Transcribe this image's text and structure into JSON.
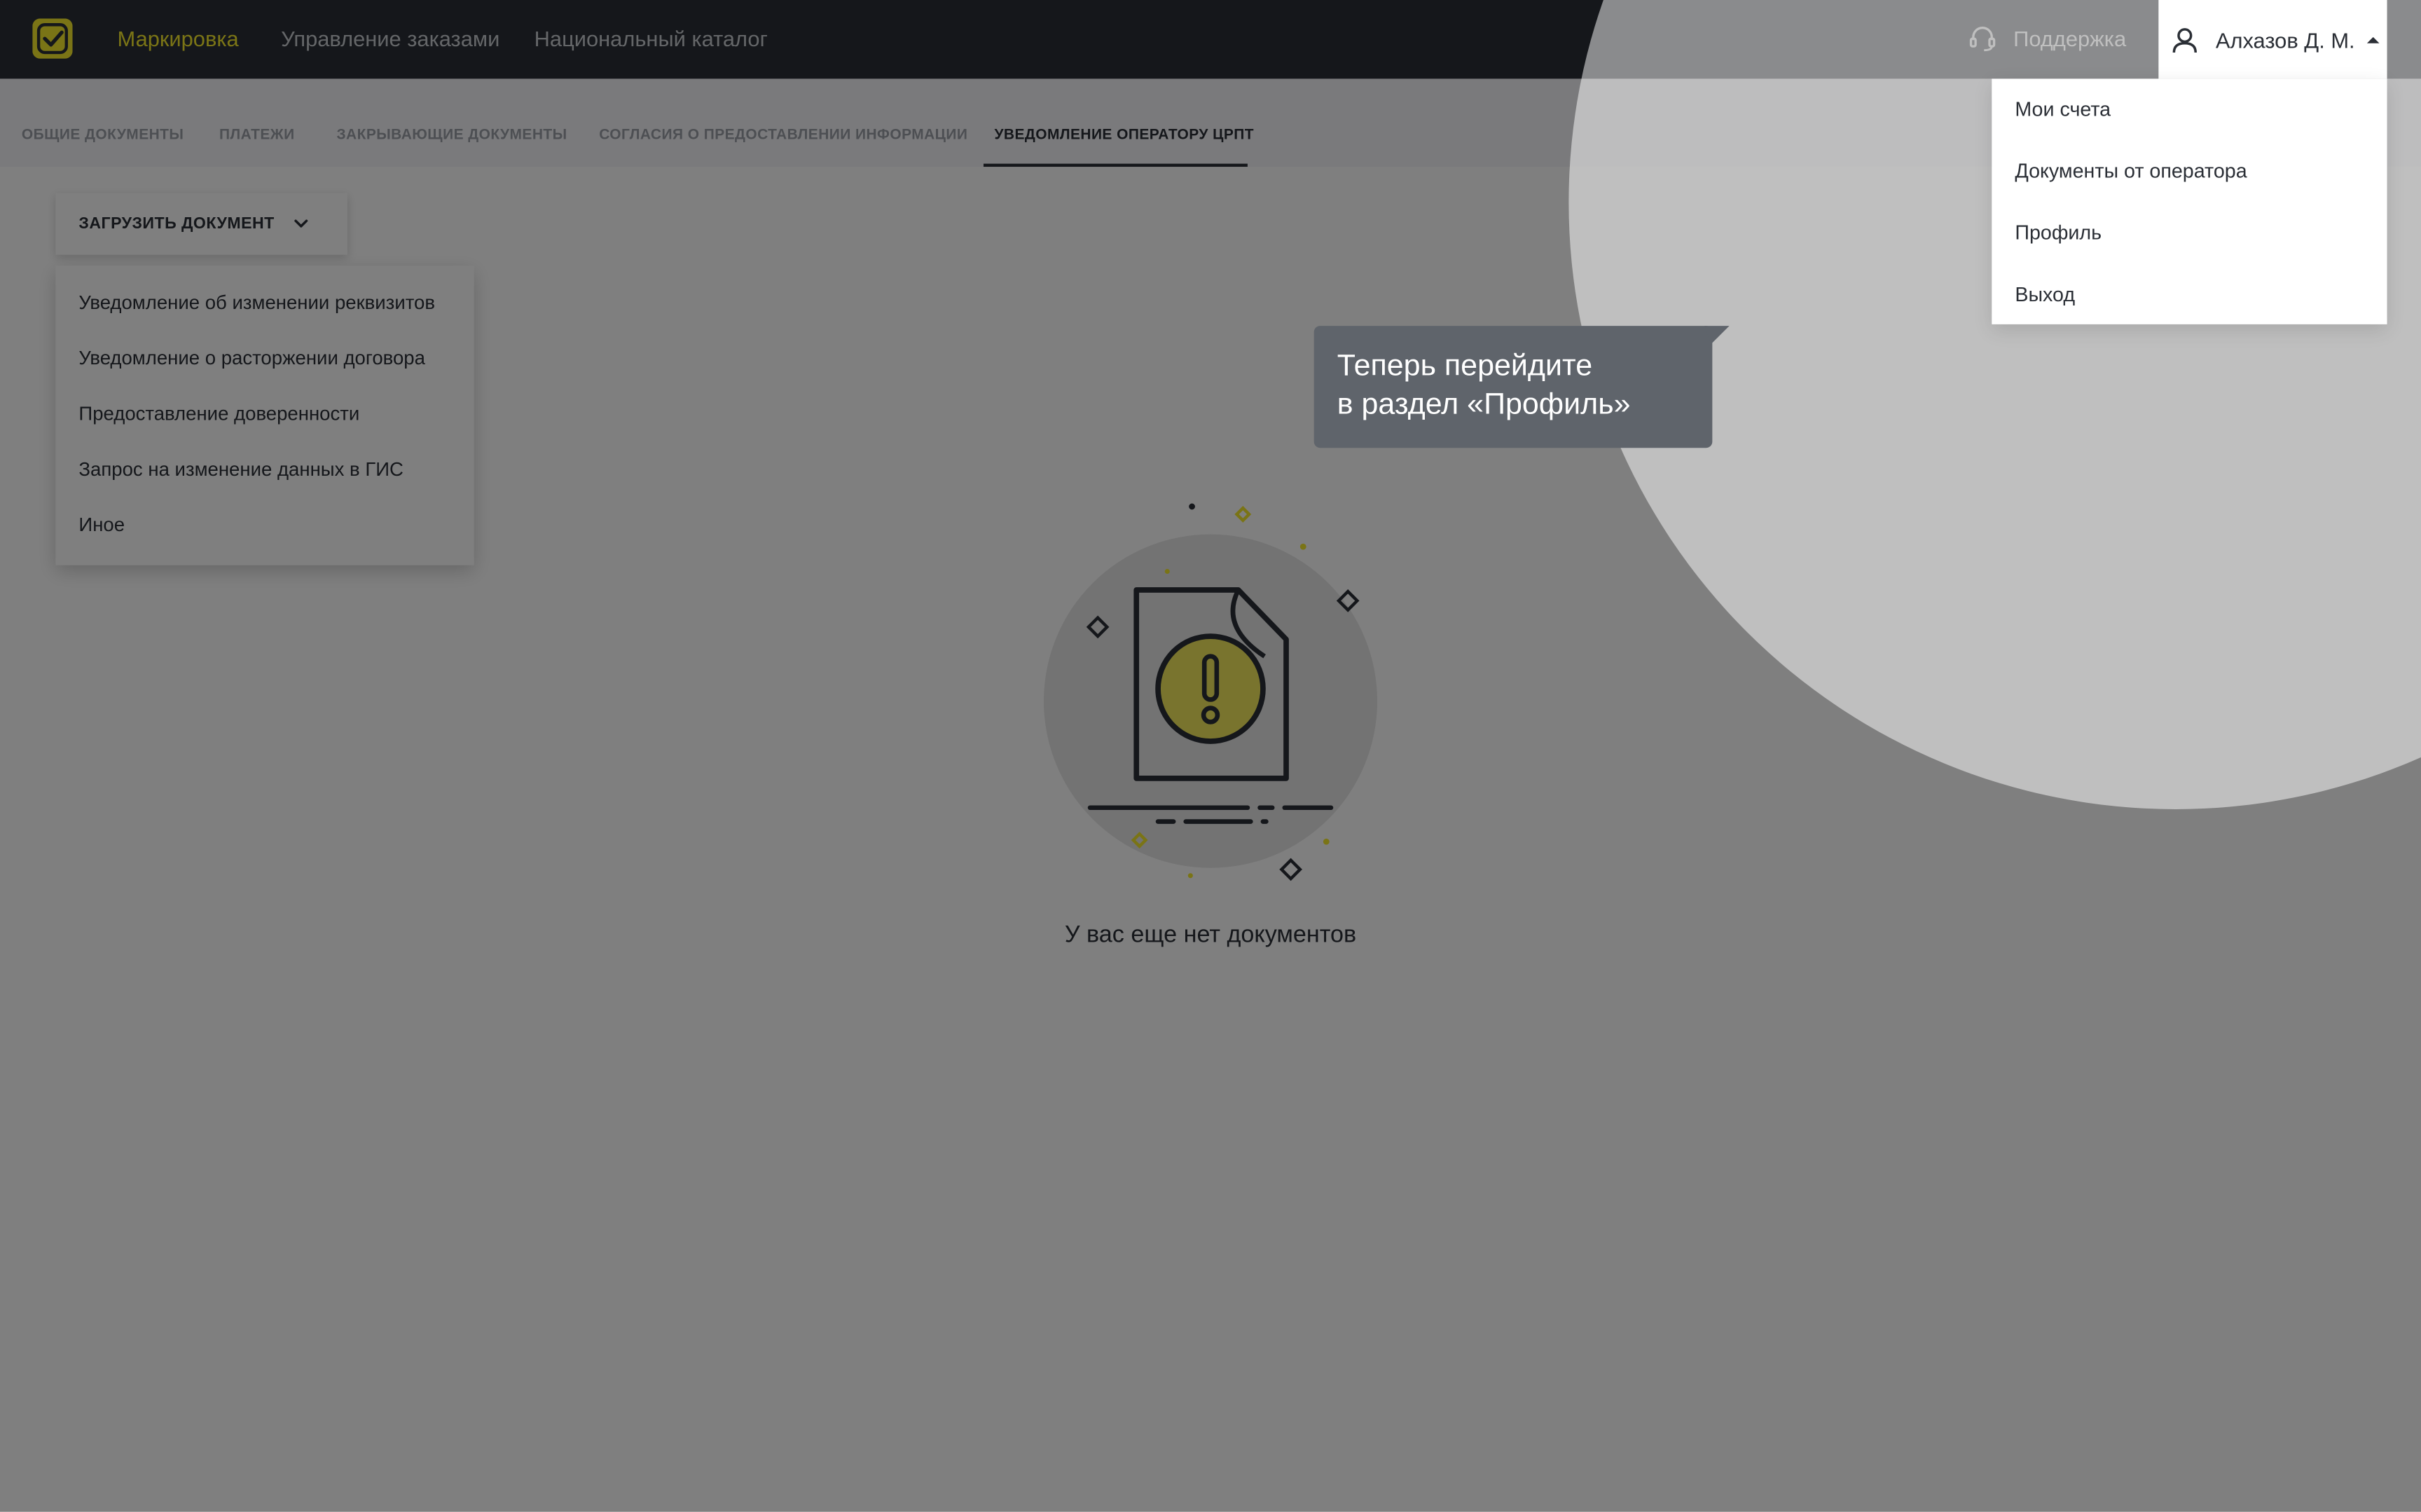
{
  "topbar": {
    "nav": [
      {
        "label": "Маркировка",
        "active": true
      },
      {
        "label": "Управление заказами",
        "active": false
      },
      {
        "label": "Национальный каталог",
        "active": false
      }
    ],
    "support_label": "Поддержка",
    "user_name": "Алхазов Д. М."
  },
  "user_menu": {
    "items": [
      {
        "label": "Мои счета"
      },
      {
        "label": "Документы от оператора"
      },
      {
        "label": "Профиль"
      },
      {
        "label": "Выход"
      }
    ]
  },
  "subtabs": [
    {
      "label": "Общие документы",
      "active": false
    },
    {
      "label": "Платежи",
      "active": false
    },
    {
      "label": "Закрывающие документы",
      "active": false
    },
    {
      "label": "Согласия о предоставлении информации",
      "active": false
    },
    {
      "label": "Уведомление оператору ЦРПТ",
      "active": true
    }
  ],
  "upload": {
    "button_label": "Загрузить документ",
    "items": [
      {
        "label": "Уведомление об изменении реквизитов"
      },
      {
        "label": "Уведомление о расторжении договора"
      },
      {
        "label": "Предоставление доверенности"
      },
      {
        "label": "Запрос на изменение данных в ГИС"
      },
      {
        "label": "Иное"
      }
    ]
  },
  "empty_state": {
    "message": "У вас еще нет документов"
  },
  "tooltip": {
    "line1": "Теперь перейдите",
    "line2": "в раздел «Профиль»"
  },
  "colors": {
    "topbar_bg": "#2a2f36",
    "brand_yellow": "#f5e92d",
    "tooltip_bg": "#5f646b"
  },
  "icons": {
    "logo": "check-badge-icon",
    "support": "headset-icon",
    "user": "user-icon",
    "user_caret": "caret-up-icon",
    "upload_chevron": "chevron-down-icon",
    "empty_illustration": "document-warning-icon"
  }
}
